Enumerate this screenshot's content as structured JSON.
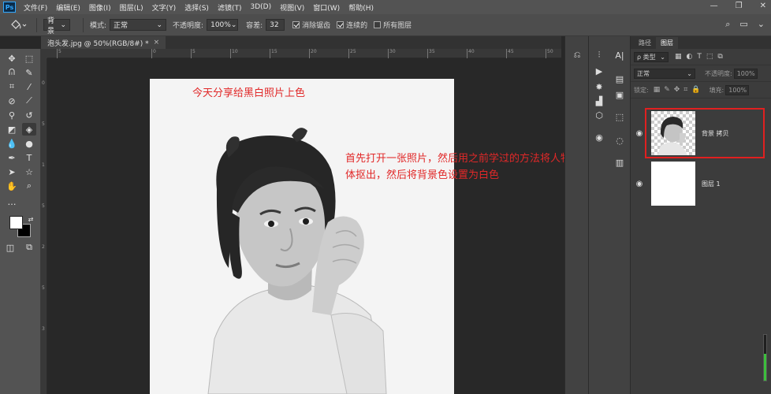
{
  "menu": [
    "文件(F)",
    "编辑(E)",
    "图像(I)",
    "图层(L)",
    "文字(Y)",
    "选择(S)",
    "滤镜(T)",
    "3D(D)",
    "视图(V)",
    "窗口(W)",
    "帮助(H)"
  ],
  "app_logo": "Ps",
  "window_controls": [
    "—",
    "❐",
    "✕"
  ],
  "options": {
    "fill_source": "背景",
    "mode_label": "模式:",
    "mode_value": "正常",
    "opacity_label": "不透明度:",
    "opacity_value": "100%",
    "tolerance_label": "容差:",
    "tolerance_value": "32",
    "antialias": "消除锯齿",
    "contiguous": "连续的",
    "all_layers": "所有图层"
  },
  "document_tab": {
    "title": "泡头发.jpg @ 50%(RGB/8#) *",
    "close": "×"
  },
  "ruler": {
    "top_ticks": [
      "5",
      "0",
      "5",
      "10",
      "15",
      "20",
      "25",
      "30",
      "35",
      "40",
      "45",
      "50"
    ],
    "left_ticks": [
      "0",
      "5",
      "1",
      "5",
      "2",
      "5",
      "3"
    ]
  },
  "canvas": {
    "annotation_title": "今天分享给黑白照片上色",
    "annotation_body": "首先打开一张照片，然后用之前学过的方法将人物主体抠出，然后将背景色设置为白色"
  },
  "layers_panel": {
    "tabs": [
      "路径",
      "图层"
    ],
    "filter_label": "ρ 类型",
    "blend_mode": "正常",
    "opacity_label": "不透明度:",
    "opacity_value": "100%",
    "lock_label": "锁定:",
    "fill_label": "填充:",
    "fill_value": "100%",
    "layers": [
      {
        "name": "背景 拷贝",
        "visible": true,
        "selected": true
      },
      {
        "name": "图层 1",
        "visible": true,
        "selected": false
      }
    ]
  },
  "colors": {
    "annotation_red": "#e12828",
    "foreground": "#ffffff",
    "background": "#000000"
  }
}
